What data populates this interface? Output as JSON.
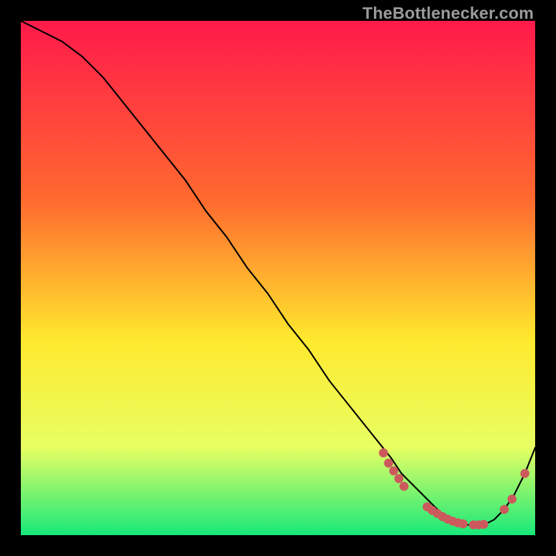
{
  "watermark": "TheBottlenecker.com",
  "chart_data": {
    "type": "line",
    "title": "",
    "xlabel": "",
    "ylabel": "",
    "xlim": [
      0,
      100
    ],
    "ylim": [
      0,
      100
    ],
    "gradient": {
      "top": "#ff1a4b",
      "mid_upper": "#ff6a2f",
      "mid": "#ffe92e",
      "mid_lower": "#e7ff63",
      "bottom": "#17e87a"
    },
    "series": [
      {
        "name": "bottleneck-curve",
        "x": [
          0,
          4,
          8,
          12,
          16,
          20,
          24,
          28,
          32,
          36,
          40,
          44,
          48,
          52,
          56,
          60,
          64,
          68,
          72,
          74,
          76,
          78,
          80,
          82,
          84,
          86,
          88,
          90,
          92,
          94,
          96,
          98,
          100
        ],
        "y": [
          100,
          98,
          96,
          93,
          89,
          84,
          79,
          74,
          69,
          63,
          58,
          52,
          47,
          41,
          36,
          30,
          25,
          20,
          15,
          12,
          10,
          8,
          6,
          4,
          3,
          2,
          2,
          2,
          3,
          5,
          8,
          12,
          17
        ]
      }
    ],
    "markers": {
      "name": "highlight-dots",
      "color": "#cc5a5d",
      "points": [
        {
          "x": 70.5,
          "y": 16
        },
        {
          "x": 71.5,
          "y": 14
        },
        {
          "x": 72.5,
          "y": 12.5
        },
        {
          "x": 73.5,
          "y": 11
        },
        {
          "x": 74.5,
          "y": 9.5
        },
        {
          "x": 79,
          "y": 5.5
        },
        {
          "x": 80,
          "y": 4.8
        },
        {
          "x": 81,
          "y": 4.2
        },
        {
          "x": 82,
          "y": 3.6
        },
        {
          "x": 83,
          "y": 3.1
        },
        {
          "x": 84,
          "y": 2.7
        },
        {
          "x": 85,
          "y": 2.4
        },
        {
          "x": 86,
          "y": 2.2
        },
        {
          "x": 88,
          "y": 2.0
        },
        {
          "x": 89,
          "y": 2.0
        },
        {
          "x": 90,
          "y": 2.1
        },
        {
          "x": 94,
          "y": 5.0
        },
        {
          "x": 95.5,
          "y": 7.0
        },
        {
          "x": 98,
          "y": 12.0
        }
      ]
    }
  }
}
